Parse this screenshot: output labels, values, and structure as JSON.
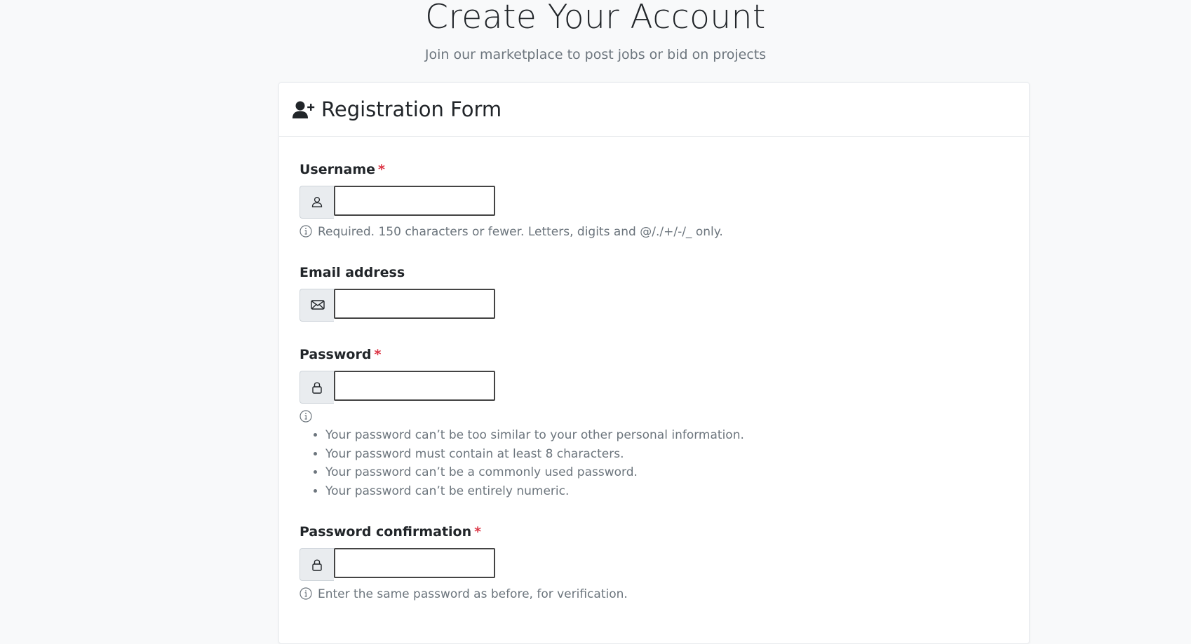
{
  "header": {
    "title": "Create Your Account",
    "subtitle": "Join our marketplace to post jobs or bid on projects"
  },
  "card": {
    "title": "Registration Form",
    "icon": "user-plus-icon"
  },
  "form": {
    "username": {
      "label": "Username",
      "required_mark": "*",
      "icon": "person-icon",
      "value": "",
      "help": "Required. 150 characters or fewer. Letters, digits and @/./+/-/_ only."
    },
    "email": {
      "label": "Email address",
      "icon": "envelope-icon",
      "value": ""
    },
    "password": {
      "label": "Password",
      "required_mark": "*",
      "icon": "lock-icon",
      "value": "",
      "help_items": [
        "Your password can’t be too similar to your other personal information.",
        "Your password must contain at least 8 characters.",
        "Your password can’t be a commonly used password.",
        "Your password can’t be entirely numeric."
      ]
    },
    "password_confirmation": {
      "label": "Password confirmation",
      "required_mark": "*",
      "icon": "lock-icon",
      "value": "",
      "help": "Enter the same password as before, for verification."
    }
  },
  "colors": {
    "page_bg": "#f8f9fa",
    "required": "#dc3545",
    "muted_text": "#6c757d",
    "addon_bg": "#e9ecef"
  }
}
